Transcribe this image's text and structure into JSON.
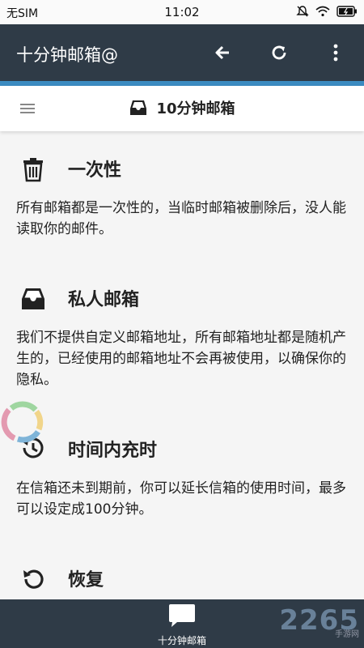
{
  "status_bar": {
    "carrier": "无SIM",
    "time": "11:02"
  },
  "app_bar": {
    "title": "十分钟邮箱@"
  },
  "header": {
    "title": "10分钟邮箱"
  },
  "sections": [
    {
      "title": "一次性",
      "text": "所有邮箱都是一次性的，当临时邮箱被删除后，没人能读取你的邮件。",
      "icon": "trash-icon"
    },
    {
      "title": "私人邮箱",
      "text": "我们不提供自定义邮箱地址，所有邮箱地址都是随机产生的，已经使用的邮箱地址不会再被使用，以确保你的隐私。",
      "icon": "inbox-icon"
    },
    {
      "title": "时间内充时",
      "text": "在信箱还未到期前，你可以延长信箱的使用时间，最多可以设定成100分钟。",
      "icon": "history-icon"
    },
    {
      "title": "恢复",
      "text": "",
      "icon": "restore-icon"
    }
  ],
  "bottom_nav": {
    "label": "十分钟邮箱"
  },
  "watermark": {
    "number": "2265",
    "sub": "手游网"
  },
  "colors": {
    "appbar": "#2f3b47",
    "accent": "#3b8bc1"
  }
}
